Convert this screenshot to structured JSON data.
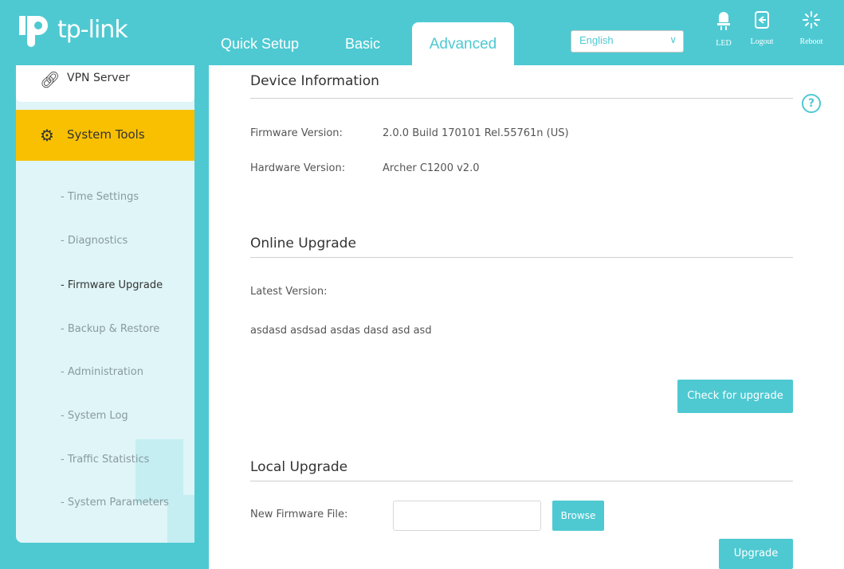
{
  "brand": {
    "name": "tp-link"
  },
  "nav": {
    "tabs": [
      {
        "label": "Quick Setup"
      },
      {
        "label": "Basic"
      },
      {
        "label": "Advanced",
        "active": true
      }
    ],
    "language": {
      "value": "English"
    },
    "actions": [
      {
        "label": "LED",
        "icon": "led-icon"
      },
      {
        "label": "Logout",
        "icon": "logout-icon"
      },
      {
        "label": "Reboot",
        "icon": "reboot-icon"
      }
    ]
  },
  "sidebar": {
    "vpn_label": "VPN Server",
    "section_label": "System Tools",
    "items": [
      {
        "label": "- Time Settings"
      },
      {
        "label": "- Diagnostics"
      },
      {
        "label": "- Firmware Upgrade",
        "active": true
      },
      {
        "label": "- Backup & Restore"
      },
      {
        "label": "- Administration"
      },
      {
        "label": "- System Log"
      },
      {
        "label": "- Traffic Statistics"
      },
      {
        "label": "- System Parameters"
      }
    ]
  },
  "device_info": {
    "title": "Device Information",
    "firmware_label": "Firmware Version:",
    "firmware_value": "2.0.0 Build 170101 Rel.55761n (US)",
    "hardware_label": "Hardware Version:",
    "hardware_value": "Archer C1200 v2.0"
  },
  "online_upgrade": {
    "title": "Online Upgrade",
    "latest_label": "Latest Version:",
    "notes": "asdasd asdsad asdas dasd asd asd",
    "check_button": "Check for upgrade"
  },
  "local_upgrade": {
    "title": "Local Upgrade",
    "file_label": "New Firmware File:",
    "file_value": "",
    "browse_button": "Browse",
    "upgrade_button": "Upgrade"
  },
  "colors": {
    "accent": "#4ec9d2",
    "highlight": "#f8c000"
  }
}
